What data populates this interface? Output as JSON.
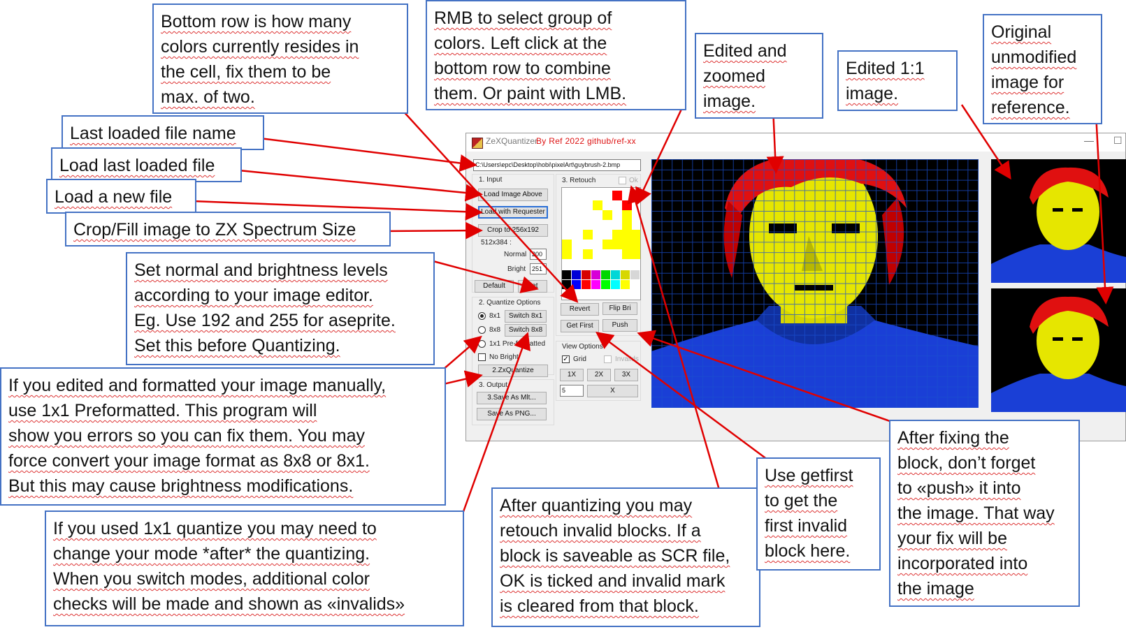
{
  "window": {
    "app_name": "ZeXQuantizer",
    "title_credit": "By Ref  2022  github/ref-xx",
    "file_path": "C:\\Users\\epc\\Desktop\\hobi\\pixelArt\\guybrush-2.bmp"
  },
  "input_group": {
    "label": "1. Input",
    "load_above": "Load Image Above",
    "load_requester": "Load with Requester",
    "crop": "Crop to 256x192",
    "size_note": "512x384 :",
    "normal_label": "Normal",
    "normal_value": "200",
    "bright_label": "Bright",
    "bright_value": "251",
    "default_btn": "Default",
    "set_btn": "Set"
  },
  "quantize_group": {
    "label": "2. Quantize Options",
    "opt_8x1": "8x1",
    "switch_8x1": "Switch 8x1",
    "opt_8x8": "8x8",
    "switch_8x8": "Switch 8x8",
    "opt_1x1": "1x1 Pre-formatted",
    "no_bright": "No Bright",
    "quantize_btn": "2.ZxQuantize",
    "selected": "8x1"
  },
  "output_group": {
    "label": "3. Output",
    "save_mlt": "3.Save As Mlt...",
    "save_png": "Save As PNG..."
  },
  "retouch_group": {
    "label": "3. Retouch",
    "ok_label": "Ok",
    "revert": "Revert",
    "flip_bri": "Flip Bri",
    "get_first": "Get First",
    "push": "Push"
  },
  "view_group": {
    "label": "View Options",
    "grid": "Grid",
    "grid_checked": true,
    "invalids": "Invalids",
    "zoom_1x": "1X",
    "zoom_2x": "2X",
    "zoom_3x": "3X",
    "step_value": "5",
    "x_btn": "X"
  },
  "palette": [
    "#000000",
    "#0000d7",
    "#d70000",
    "#d700d7",
    "#00d700",
    "#00d7d7",
    "#d7d700",
    "#d7d7d7",
    "#000000",
    "#0000ff",
    "#ff0000",
    "#ff00ff",
    "#00ff00",
    "#00ffff",
    "#ffff00",
    "#ffffff"
  ],
  "callouts": {
    "bottom_row": [
      "Bottom row is how many",
      "colors currently resides in",
      "the cell, fix them to be",
      "max. of two."
    ],
    "rmb": [
      "RMB to select group of",
      "colors. Left click at the",
      "bottom row to combine",
      "them. Or paint with LMB."
    ],
    "edited_zoomed": [
      "Edited and",
      "zoomed",
      "image."
    ],
    "edited_11": [
      "Edited 1:1",
      "image."
    ],
    "original": [
      "Original",
      "unmodified",
      "image for",
      "reference."
    ],
    "last_name": [
      "Last loaded file name"
    ],
    "load_last": [
      "Load last loaded file"
    ],
    "load_new": [
      "Load a new file"
    ],
    "crop_fill": [
      "Crop/Fill image to ZX Spectrum Size"
    ],
    "set_levels": [
      "Set normal and brightness levels",
      "according to your image editor.",
      "Eg. Use 192 and 255 for aseprite.",
      "Set this before Quantizing."
    ],
    "manual": [
      "If you edited and formatted your image manually,",
      " use 1x1 Preformatted. This program will",
      "show you errors so you can fix them. You may",
      "force convert your image format as 8x8 or 8x1.",
      "But this may cause brightness modifications."
    ],
    "quantize_1x1": [
      "If you used 1x1 quantize you may need to",
      "change your mode *after* the quantizing.",
      "When you switch modes, additional color",
      "checks will be made and shown as «invalids»"
    ],
    "after_quantizing": [
      "After quantizing you may",
      "retouch invalid blocks. If a",
      "block is saveable as SCR file,",
      "OK is ticked and invalid mark",
      "is cleared from that block."
    ],
    "getfirst": [
      "Use getfirst",
      "to get the",
      "first invalid",
      "block here."
    ],
    "push_note": [
      "After fixing the",
      "block, don’t forget",
      "to «push» it into",
      "the image. That way",
      "your fix will be",
      "incorporated into",
      "the image"
    ]
  }
}
